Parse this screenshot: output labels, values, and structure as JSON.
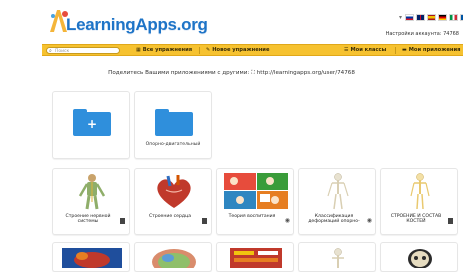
{
  "header": {
    "logo_text": "LearningApps.org",
    "account_text": "Настройки аккаунта: 74768",
    "flag_colors": [
      [
        "#ce1126",
        "#ffffff",
        "#0033a0"
      ],
      [
        "#012169",
        "#c8102e",
        "#ffffff"
      ],
      [
        "#aa151b",
        "#f1bf00",
        "#aa151b"
      ],
      [
        "#000000",
        "#dd0000",
        "#ffce00"
      ],
      [
        "#009246",
        "#ffffff",
        "#ce2b37"
      ],
      [
        "#0055a4",
        "#ffffff",
        "#ef4135"
      ]
    ]
  },
  "nav": {
    "search_placeholder": "Поиск",
    "items": [
      {
        "label": "Все упражнения",
        "icon": "grid-icon"
      },
      {
        "label": "Новое упражнение",
        "icon": "pencil-icon"
      },
      {
        "label": "Мои классы",
        "icon": "list-icon"
      },
      {
        "label": "Мои приложения",
        "icon": "folder-icon"
      }
    ]
  },
  "share": {
    "text": "Поделитесь Вашими приложениями с другими:",
    "url": "http://learningapps.org/user/74768"
  },
  "folders": [
    {
      "label": "",
      "kind": "new-folder"
    },
    {
      "label": "Опорно-двигательный",
      "kind": "folder"
    }
  ],
  "apps_row1": [
    {
      "label": "Строение нервной системы",
      "icon": "bookmark-icon"
    },
    {
      "label": "Строение сердца",
      "icon": "bookmark-icon"
    },
    {
      "label": "Теория воспитания",
      "icon": "eye-icon"
    },
    {
      "label": "Классификация деформаций опорно-",
      "icon": "eye-icon"
    },
    {
      "label": "СТРОЕНИЕ И СОСТАВ КОСТЕЙ",
      "icon": "bookmark-icon"
    }
  ],
  "colors": {
    "brand_blue": "#1e74c7",
    "nav_yellow": "#f6c230",
    "folder_blue": "#2f8fdc"
  }
}
